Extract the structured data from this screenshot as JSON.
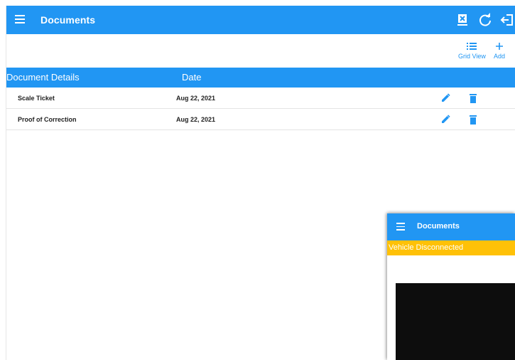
{
  "appbar": {
    "title": "Documents",
    "actions": [
      "scanner-icon",
      "refresh-icon",
      "logout-icon"
    ]
  },
  "toolbar": {
    "grid_view_label": "Grid View",
    "add_label": "Add"
  },
  "table": {
    "columns": [
      "Document Details",
      "Date"
    ],
    "rows": [
      {
        "name": "Scale Ticket",
        "date": "Aug 22, 2021"
      },
      {
        "name": "Proof of Correction",
        "date": "Aug 22, 2021"
      }
    ]
  },
  "inset": {
    "title": "Documents",
    "banner": "Vehicle Disconnected"
  },
  "colors": {
    "primary": "#2196f3",
    "warning": "#ffc107"
  }
}
